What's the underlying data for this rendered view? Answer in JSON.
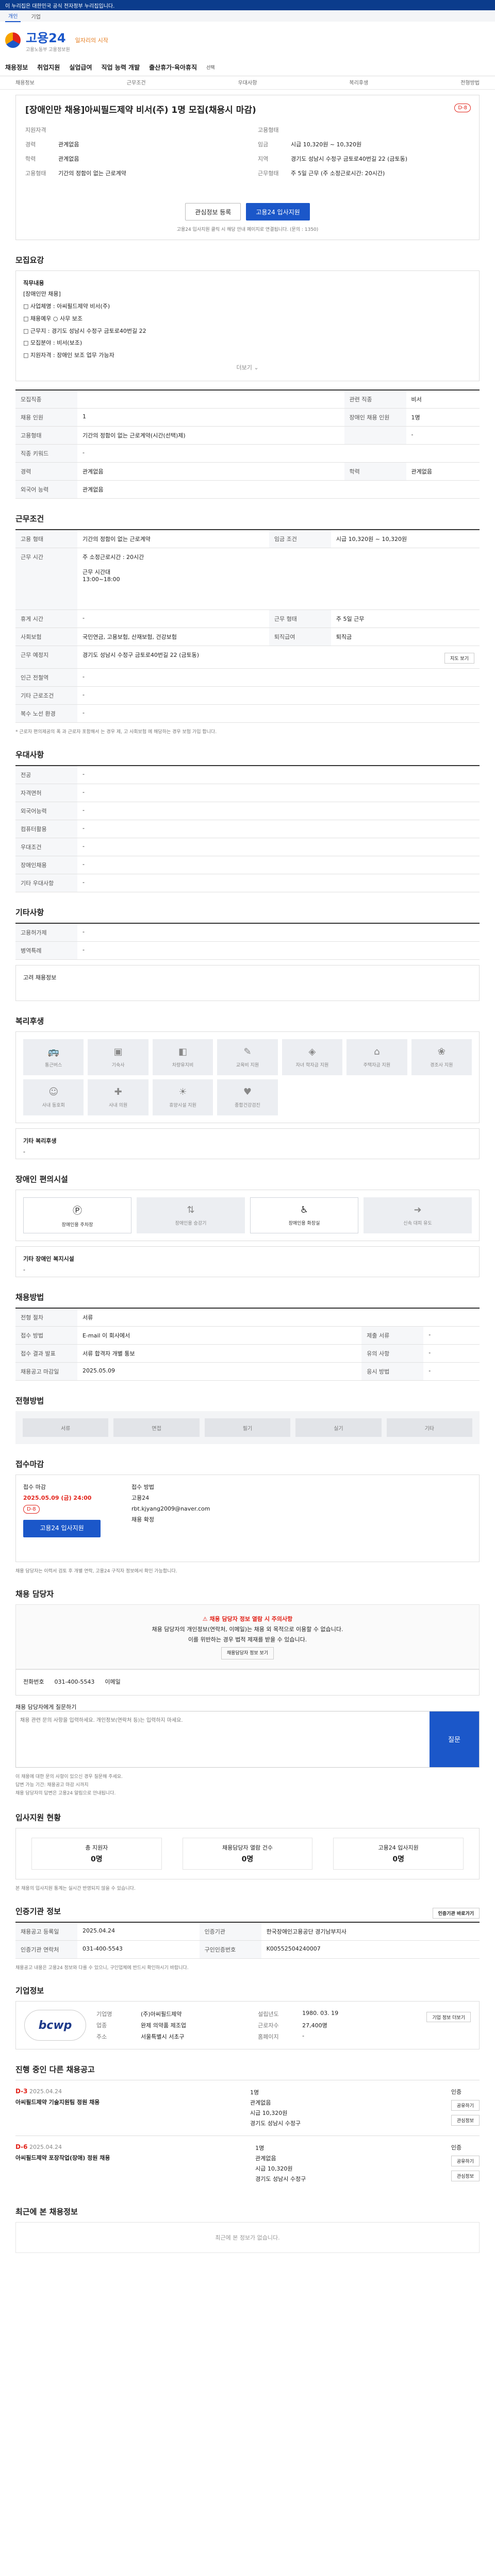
{
  "topbar": "이 누리집은 대한민국 공식 전자정부 누리집입니다.",
  "gov_tabs": [
    "개인",
    "기업"
  ],
  "logo": {
    "title": "고용24",
    "sub": "고용노동부 고용정보원",
    "slogan": "일자리의 시작"
  },
  "gnb": [
    "채용정보",
    "취업지원",
    "실업급여",
    "직업 능력 개발",
    "출산휴가·육아휴직"
  ],
  "gnb_small": "선택",
  "subnav": [
    "채용정보",
    "근무조건",
    "우대사항",
    "복리후생",
    "전형방법"
  ],
  "title": {
    "heading": "[장애인만 채용]아씨필드제약 비서(주) 1명 모집(채용시 마감)",
    "tag": "D-8"
  },
  "summary": [
    [
      "지원자격",
      ""
    ],
    [
      "경력",
      "관계없음"
    ],
    [
      "학력",
      "관계없음"
    ],
    [
      "임금",
      "시급 10,320원 ~ 10,320원"
    ],
    [
      "지역",
      "경기도 성남시 수정구 금토로40번길 22 (금토동)"
    ],
    [
      "고용형태",
      ""
    ],
    [
      "고용형태",
      "기간의 정함이 없는 근로계약"
    ],
    [
      "근무형태",
      "주 5일 근무 (주 소정근로시간: 20시간)"
    ]
  ],
  "btn_scrap": "관심정보 등록",
  "btn_apply": "고용24 입사지원",
  "btn_note": "고용24 입사지원 클릭 시 해당 안내 페이지로 연결됩니다. (문의 : 1350)",
  "s_recruit": "모집요강",
  "duty_title": "직무내용",
  "duties": [
    "[장애인만 채용]",
    "사업체명 : 아씨필드제약 비서(주)",
    "채용예우 ○ 사무 보조",
    "근무지 : 경기도 성남시 수정구 금토로40번길 22",
    "모집분야 : 비서(보조)",
    "지원자격 : 장애인 보조 업무 가능자",
    "기타 문의 : 사업장 담당자"
  ],
  "more": "더보기",
  "recruit_tbl": [
    [
      "모집직종",
      "",
      "관련 직종",
      "비서"
    ],
    [
      "채용 인원",
      "1",
      "장애인 채용 인원",
      "1명"
    ],
    [
      "고용형태",
      "기간의 정함이 없는 근로계약(시간(선택)제)",
      "",
      "-"
    ],
    [
      "직종 키워드",
      "-",
      "",
      ""
    ],
    [
      "경력",
      "관계없음",
      "학력",
      "관계없음"
    ],
    [
      "외국어 능력",
      "관계없음",
      "",
      ""
    ]
  ],
  "s_cond": "근무조건",
  "cond": {
    "type": "기간의 정함이 없는 근로계약",
    "wage": "시급 10,320원 ~ 10,320원",
    "hours_note": "주 소정근로시간 : 20시간",
    "day": "주 5일 근무",
    "meal": "-",
    "insurance": "국민연금, 고용보험, 산재보험, 건강보험",
    "retire": "퇴직금",
    "addr": "경기도 성남시 수정구 금토로40번길 22 (금토동)",
    "map": "지도 보기",
    "time_label": "근무 시간",
    "time": "13:00~18:00",
    "work_time_label": "근무 시간대",
    "holiday": "주 5일 근무",
    "note": "* 근로자 편의제공의 폭 과 근로자 포함해서 는 경우 제, 고 사회보험 에 해당하는 경우 보험 가입 합니다."
  },
  "s_pref": "우대사항",
  "pref": [
    [
      "전공",
      "-"
    ],
    [
      "자격면허",
      "-"
    ],
    [
      "외국어능력",
      "-"
    ],
    [
      "컴퓨터활용",
      "-"
    ],
    [
      "우대조건",
      "-"
    ],
    [
      "장애인채용",
      "-"
    ],
    [
      "기타 우대사항",
      "-"
    ]
  ],
  "s_etc": "기타사항",
  "etc": [
    [
      "고용허가제",
      "-"
    ],
    [
      "병역특례",
      "-"
    ]
  ],
  "etc_note": "고려 채용정보",
  "s_welfare": "복리후생",
  "welfare_icons": [
    "통근버스",
    "기숙사",
    "차량유지비",
    "교육비 지원",
    "자녀 학자금 지원",
    "주택자금 지원",
    "경조사 지원",
    "사내 동호회",
    "사내 의원",
    "휴양시설 지원",
    "종합건강검진"
  ],
  "welfare_etc": "기타 복리후생",
  "s_disab": "장애인 편의시설",
  "disab_icons": [
    "장애인용 주차장",
    "장애인용 승강기",
    "장애인용 화장실",
    "신속 대피 유도"
  ],
  "disab_etc": "기타 장애인 복지시설",
  "s_method": "채용방법",
  "method": [
    [
      "전형 절차",
      "서류"
    ],
    [
      "접수 방법",
      "E-mail 이 회사에서",
      "제출 서류",
      "-"
    ],
    [
      "접수 결과 발표",
      "서류 합격자 개별 통보",
      "유의 사항",
      "-"
    ],
    [
      "채용공고 마감일",
      "2025.05.09",
      "응시 방법",
      "-"
    ]
  ],
  "s_step": "전형방법",
  "steps": [
    "서류",
    "면접",
    "필기",
    "실기",
    "기타"
  ],
  "s_apply": "접수마감",
  "apply": {
    "deadline_label": "접수 마감",
    "deadline": "2025.05.09 (금) 24:00",
    "dday": "D-8",
    "btn": "고용24 입사지원",
    "method_label": "접수 방법",
    "method": "고용24",
    "email": "rbt.kjyang2009@naver.com",
    "cert": "채용 확정"
  },
  "apply_note": "채용 담당자는 이력서 검토 후 개별 연락, 고용24 구직자 정보에서 확인 가능합니다.",
  "s_contact": "채용 담당자",
  "contact_warn": "채용 담당자 정보 열람 시 주의사항",
  "contact_lines": [
    "채용 담당자의 개인정보(연락처, 이메일)는 채용 외 목적으로 이용할 수 없습니다.",
    "이를 위반하는 경우 법적 제재를 받을 수 있습니다."
  ],
  "contact_btn": "채용담당자 정보 보기",
  "contact_row": [
    "전화번호",
    "031-400-5543",
    "이메일"
  ],
  "qa_label": "채용 담당자에게 질문하기",
  "qa_placeholder": "채용 관련 문의 사항을 입력하세요. 개인정보(연락처 등)는 입력하지 마세요.",
  "qa_send": "질문",
  "qa_notes": [
    "이 채용에 대한 문의 사항이 있으신 경우 질문해 주세요.",
    "답변 가능 기간: 채용공고 마감 시까지",
    "채용 담당자의 답변은 고용24 알림으로 안내됩니다."
  ],
  "s_stats": "입사지원 현황",
  "stats": [
    [
      "총 지원자",
      "0명"
    ],
    [
      "채용담당자 열람 건수",
      "0명"
    ],
    [
      "고용24 입사지원",
      "0명"
    ]
  ],
  "stats_note": "본 채용의 입사지원 통계는 실시간 반영되지 않을 수 있습니다.",
  "s_agency": "인증기관 정보",
  "agency_btn": "인증기관 바로가기",
  "agency": [
    [
      "채용공고 등록일",
      "2025.04.24",
      "인증기관",
      "한국장애인고용공단 경기남부지사"
    ],
    [
      "인증기관 연락처",
      "031-400-5543",
      "구인인증번호",
      "K00552504240007"
    ]
  ],
  "agency_note": "채용공고 내용은 고용24 정보와 다를 수 있으니, 구인업체에 반드시 확인하시기 바랍니다.",
  "s_company": "기업정보",
  "company": {
    "logo": "bcwp",
    "name": "(주)아씨필드제약",
    "owner": "대표자",
    "estab_label": "설립년도",
    "estab": "1980. 03. 19",
    "industry_label": "업종",
    "industry": "완제 의약품 제조업",
    "emp_label": "근로자수",
    "emp": "27,400명",
    "homepage": "홈페이지",
    "addr_label": "주소",
    "addr": "서울특별시 서초구"
  },
  "company_btn": "기업 정보 더보기",
  "s_other": "진행 중인 다른 채용공고",
  "jobs": [
    {
      "dday": "D-3",
      "date": "2025.04.24",
      "title": "아씨필드제약 기술지원팀 정원 채용",
      "conds": [
        "1명",
        "관계없음",
        "시급 10,320원",
        "경기도 성남시 수정구"
      ],
      "cert": "인증",
      "btns": [
        "공유하기",
        "관심정보"
      ]
    },
    {
      "dday": "D-6",
      "date": "2025.04.24",
      "title": "아씨필드제약 포장작업(장애) 정원 채용",
      "conds": [
        "1명",
        "관계없음",
        "시급 10,320원",
        "경기도 성남시 수정구"
      ],
      "cert": "인증",
      "btns": [
        "공유하기",
        "관심정보"
      ]
    }
  ],
  "s_recent": "최근에 본 채용정보",
  "recent_empty": "최근에 본 정보가 없습니다."
}
